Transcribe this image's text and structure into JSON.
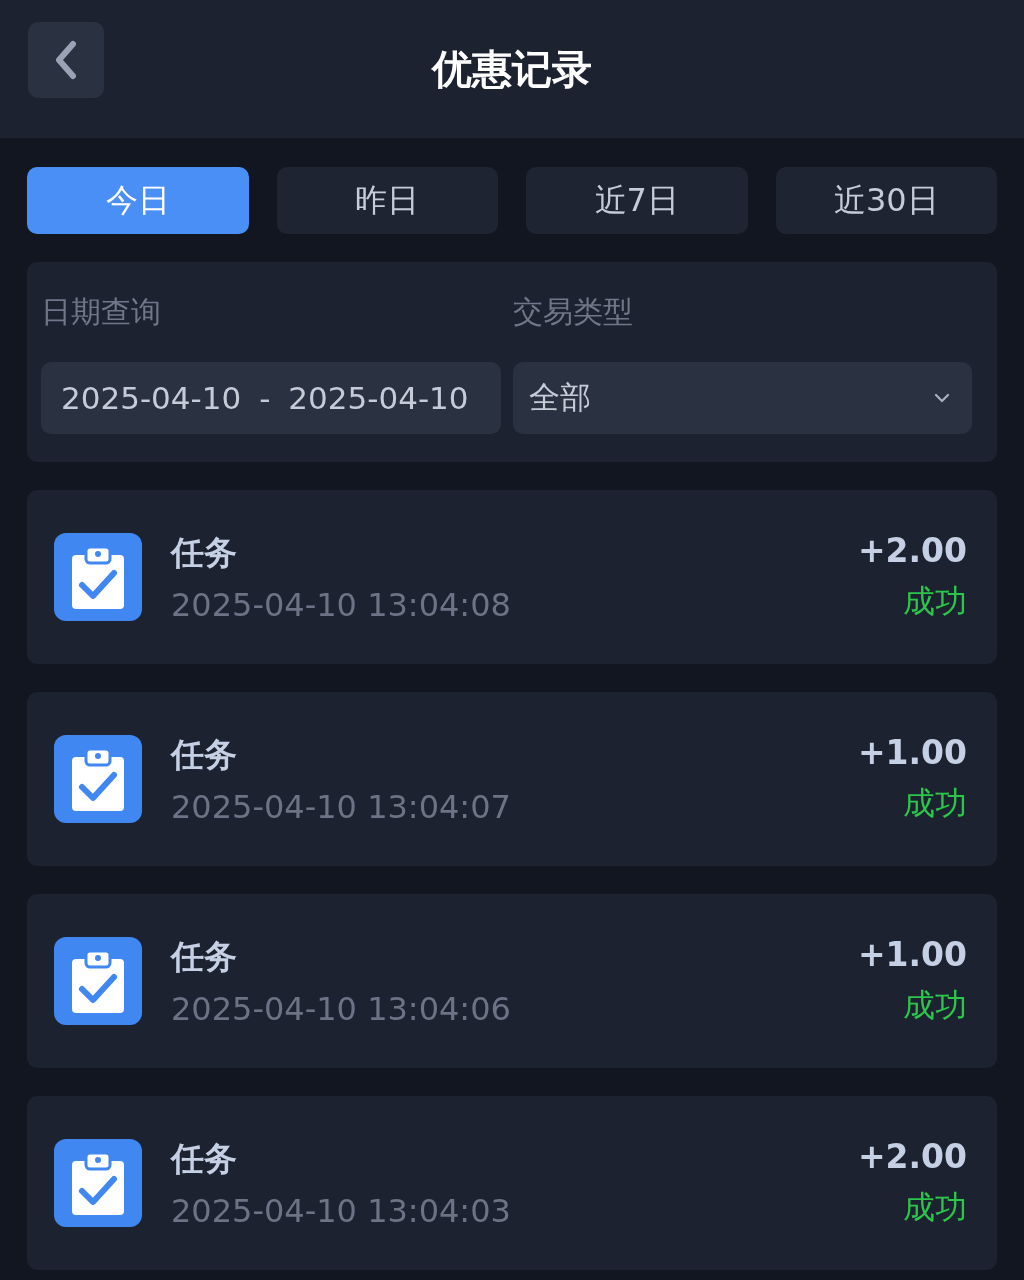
{
  "header": {
    "title": "优惠记录"
  },
  "tabs": [
    {
      "label": "今日",
      "selected": true
    },
    {
      "label": "昨日",
      "selected": false
    },
    {
      "label": "近7日",
      "selected": false
    },
    {
      "label": "近30日",
      "selected": false
    }
  ],
  "filters": {
    "date_label": "日期查询",
    "date_start": "2025-04-10",
    "date_separator": "-",
    "date_end": "2025-04-10",
    "type_label": "交易类型",
    "type_value": "全部"
  },
  "records": [
    {
      "title": "任务",
      "time": "2025-04-10 13:04:08",
      "amount": "+2.00",
      "status": "成功"
    },
    {
      "title": "任务",
      "time": "2025-04-10 13:04:07",
      "amount": "+1.00",
      "status": "成功"
    },
    {
      "title": "任务",
      "time": "2025-04-10 13:04:06",
      "amount": "+1.00",
      "status": "成功"
    },
    {
      "title": "任务",
      "time": "2025-04-10 13:04:03",
      "amount": "+2.00",
      "status": "成功"
    }
  ]
}
